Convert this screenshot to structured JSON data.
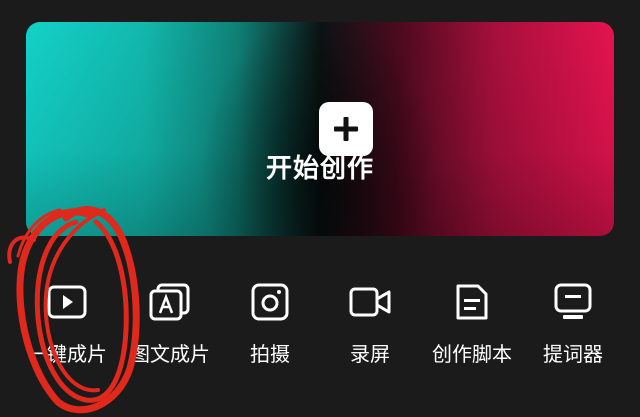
{
  "create_card": {
    "label": "开始创作",
    "icon": "plus-icon"
  },
  "tools": [
    {
      "label": "一键成片",
      "icon": "play-square-icon"
    },
    {
      "label": "图文成片",
      "icon": "image-text-icon"
    },
    {
      "label": "拍摄",
      "icon": "camera-icon"
    },
    {
      "label": "录屏",
      "icon": "video-camera-icon"
    },
    {
      "label": "创作脚本",
      "icon": "document-icon"
    },
    {
      "label": "提词器",
      "icon": "teleprompter-icon"
    }
  ],
  "colors": {
    "background": "#1b1b1b",
    "gradient_left": "#13d2c8",
    "gradient_right": "#e5134f",
    "annotation": "#e0281c"
  }
}
